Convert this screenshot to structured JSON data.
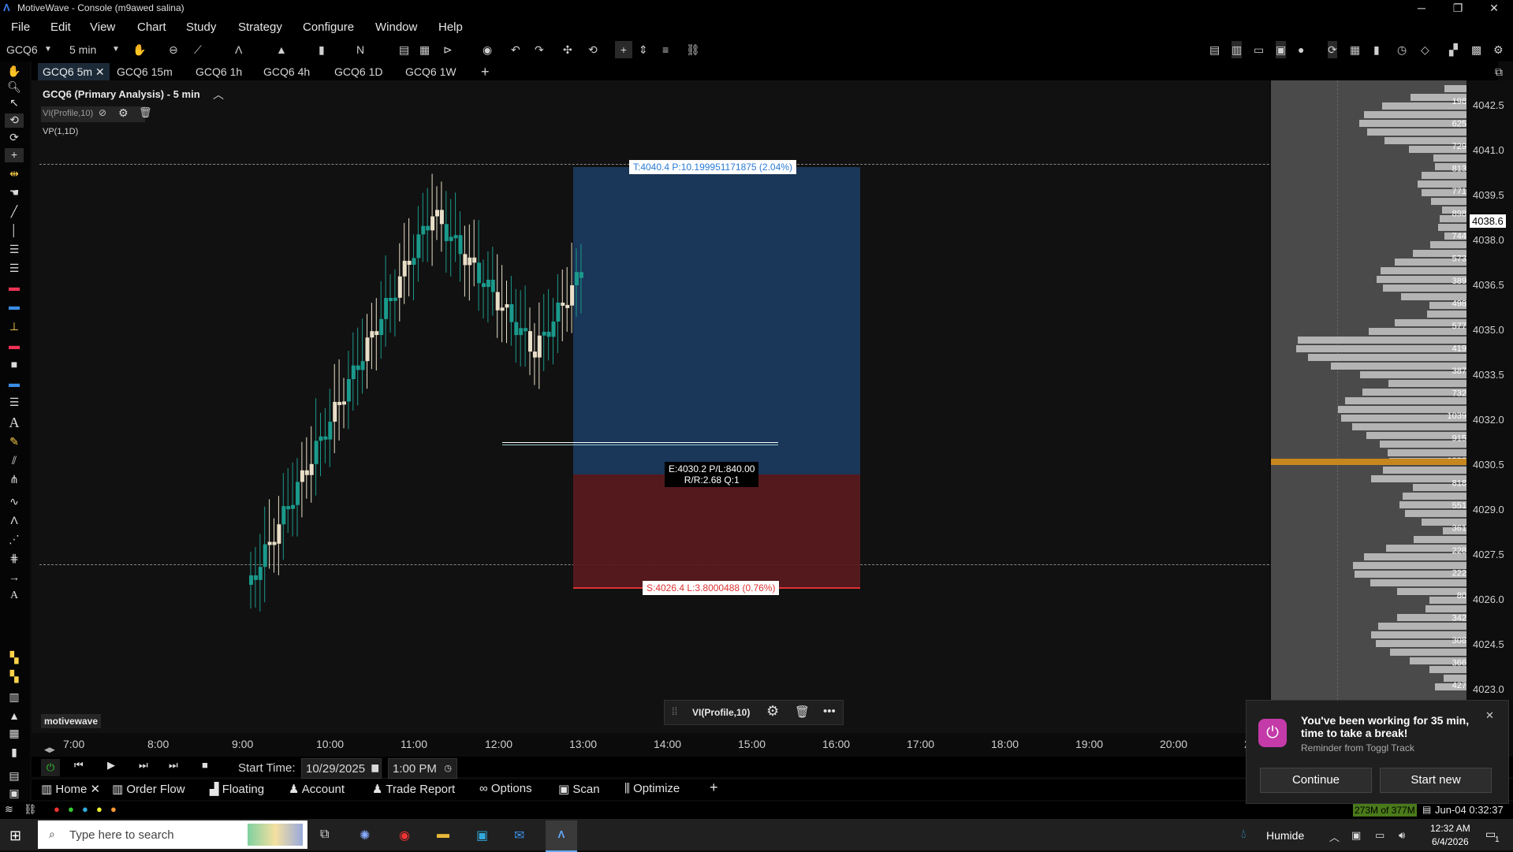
{
  "window": {
    "app_title": "MotiveWave - Console (m9awed salina)"
  },
  "menu": [
    "File",
    "Edit",
    "View",
    "Chart",
    "Study",
    "Strategy",
    "Configure",
    "Window",
    "Help"
  ],
  "toolbar": {
    "symbol": "GCQ6",
    "interval": "5 min"
  },
  "tabs": [
    "GCQ6 5m",
    "GCQ6 15m",
    "GCQ6 1h",
    "GCQ6 4h",
    "GCQ6 1D",
    "GCQ6 1W"
  ],
  "chart": {
    "header": "GCQ6 (Primary Analysis) - 5 min",
    "study1": "VI(Profile,10)",
    "study2": "VP(1,1D)",
    "watermark": "motivewave",
    "current_price": "4038.6",
    "target_label": "T:4040.4 P:10.199951171875 (2.04%)",
    "entry_label_1": "E:4030.2 P/L:840.00",
    "entry_label_2": "R/R:2.68 Q:1",
    "stop_label": "S:4026.4 L:3.8000488 (0.76%)",
    "study_popup": "VI(Profile,10)",
    "price_ticks": [
      "4042.5",
      "4041.0",
      "4039.5",
      "4038.0",
      "4036.5",
      "4035.0",
      "4033.5",
      "4032.0",
      "4030.5",
      "4029.0",
      "4027.5",
      "4026.0",
      "4024.5",
      "4023.0"
    ],
    "time_ticks": [
      "7:00",
      "8:00",
      "9:00",
      "10:00",
      "11:00",
      "12:00",
      "13:00",
      "14:00",
      "15:00",
      "16:00",
      "17:00",
      "18:00",
      "19:00",
      "20:00",
      "2"
    ],
    "vp_counts": [
      "198",
      "625",
      "729",
      "813",
      "771",
      "898",
      "744",
      "573",
      "389",
      "498",
      "577",
      "419",
      "387",
      "732",
      "1039",
      "915",
      "1092",
      "818",
      "551",
      "361",
      "228",
      "222",
      "80",
      "342",
      "308",
      "366",
      "427"
    ]
  },
  "replay": {
    "start_label": "Start Time:",
    "date": "10/29/2025",
    "time": "1:00 PM"
  },
  "workspace_tabs": [
    "Home",
    "Order Flow",
    "Floating",
    "Account",
    "Trade Report",
    "Options",
    "Scan",
    "Optimize"
  ],
  "status": {
    "memory": "273M of 377M",
    "datetime": "Jun-04 0:32:37"
  },
  "toast": {
    "title_1": "You've been working for 35 min,",
    "title_2": "time to take a break!",
    "subtitle": "Reminder from Toggl Track",
    "continue": "Continue",
    "start_new": "Start new"
  },
  "taskbar": {
    "search_placeholder": "Type here to search",
    "weather": "Humide",
    "time": "12:32 AM",
    "date": "6/4/2026",
    "notifications": "1"
  },
  "colors": {
    "bull": "#1a9a8c",
    "bear": "#e9dfc8",
    "target": "#1b3a5e",
    "stop": "#5a1a1e",
    "poc": "#c8861e"
  }
}
